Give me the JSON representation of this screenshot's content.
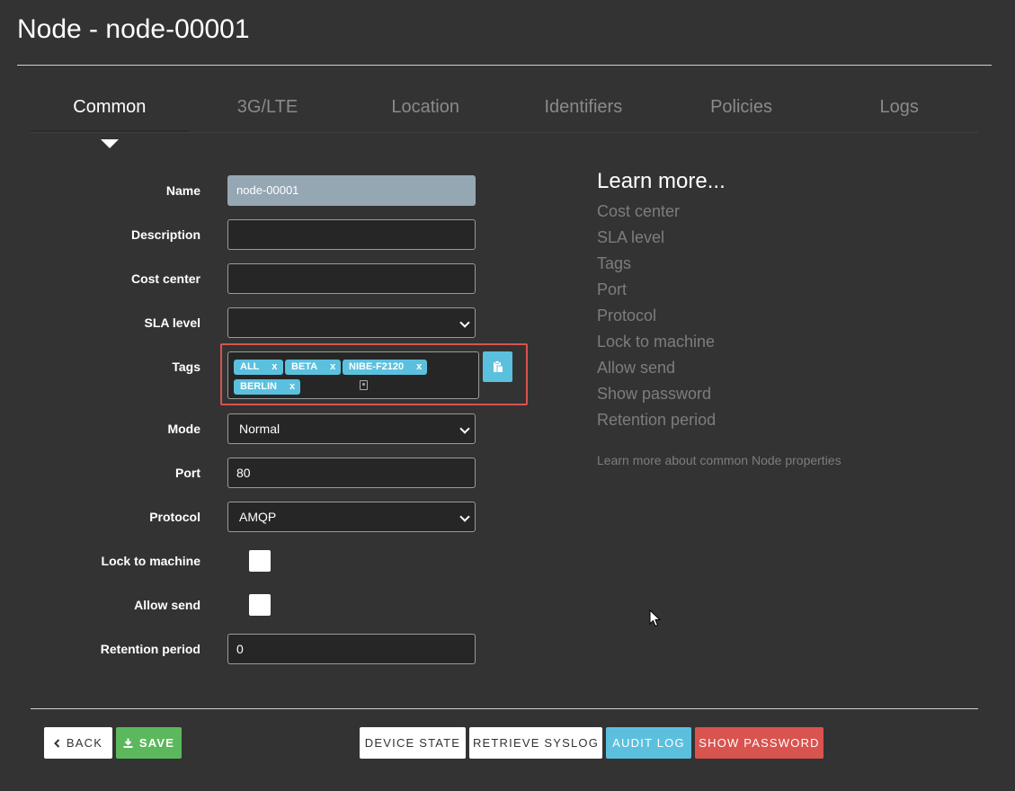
{
  "page": {
    "title": "Node - node-00001"
  },
  "tabs": [
    {
      "label": "Common",
      "active": true
    },
    {
      "label": "3G/LTE",
      "active": false
    },
    {
      "label": "Location",
      "active": false
    },
    {
      "label": "Identifiers",
      "active": false
    },
    {
      "label": "Policies",
      "active": false
    },
    {
      "label": "Logs",
      "active": false
    }
  ],
  "form": {
    "name": {
      "label": "Name",
      "value": "node-00001"
    },
    "description": {
      "label": "Description",
      "value": ""
    },
    "cost_center": {
      "label": "Cost center",
      "value": ""
    },
    "sla_level": {
      "label": "SLA level",
      "value": ""
    },
    "tags": {
      "label": "Tags",
      "items": [
        "ALL",
        "BETA",
        "NIBE-F2120",
        "BERLIN"
      ],
      "remove_glyph": "x"
    },
    "mode": {
      "label": "Mode",
      "value": "Normal"
    },
    "port": {
      "label": "Port",
      "value": "80"
    },
    "protocol": {
      "label": "Protocol",
      "value": "AMQP"
    },
    "lock_to_machine": {
      "label": "Lock to machine",
      "checked": false
    },
    "allow_send": {
      "label": "Allow send",
      "checked": false
    },
    "retention_period": {
      "label": "Retention period",
      "value": "0"
    }
  },
  "learn_more": {
    "title": "Learn more...",
    "items": [
      "Cost center",
      "SLA level",
      "Tags",
      "Port",
      "Protocol",
      "Lock to machine",
      "Allow send",
      "Show password",
      "Retention period"
    ],
    "footer_link": "Learn more about common Node properties"
  },
  "buttons": {
    "back": "BACK",
    "save": "SAVE",
    "device_state": "DEVICE STATE",
    "retrieve_syslog": "RETRIEVE SYSLOG",
    "audit_log": "AUDIT LOG",
    "show_password": "SHOW PASSWORD"
  },
  "colors": {
    "background": "#333333",
    "info": "#5bc0de",
    "success": "#5cb85c",
    "danger": "#d9534f",
    "readonly_field": "#95a7b3"
  },
  "icons": {
    "back": "chevron-left-icon",
    "save": "download-icon",
    "paste": "clipboard-icon",
    "tag_input": "contact-card-icon",
    "pointer": "mouse-cursor-icon"
  }
}
